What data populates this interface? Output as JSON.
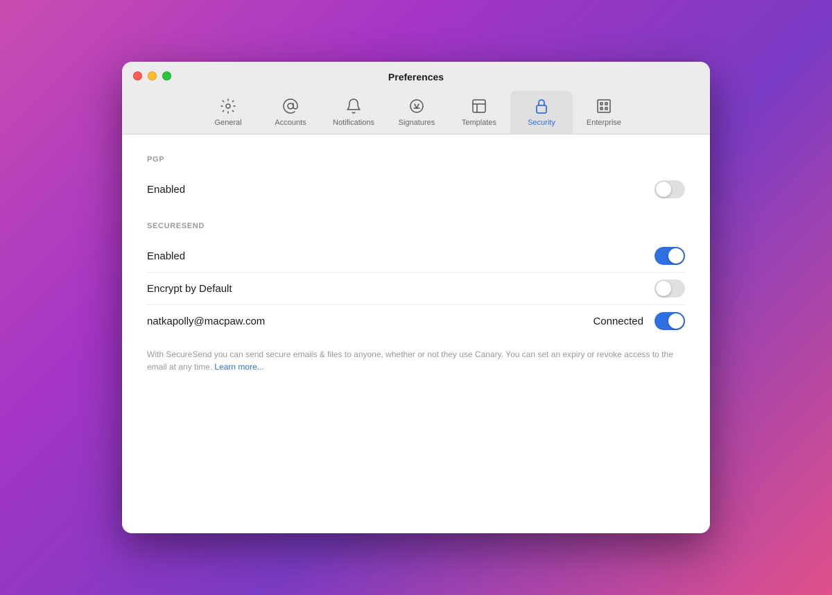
{
  "window": {
    "title": "Preferences"
  },
  "traffic_lights": {
    "close": "close",
    "minimize": "minimize",
    "maximize": "maximize"
  },
  "tabs": [
    {
      "id": "general",
      "label": "General",
      "icon": "gear-icon",
      "active": false
    },
    {
      "id": "accounts",
      "label": "Accounts",
      "icon": "at-icon",
      "active": false
    },
    {
      "id": "notifications",
      "label": "Notifications",
      "icon": "bell-icon",
      "active": false
    },
    {
      "id": "signatures",
      "label": "Signatures",
      "icon": "signature-icon",
      "active": false
    },
    {
      "id": "templates",
      "label": "Templates",
      "icon": "templates-icon",
      "active": false
    },
    {
      "id": "security",
      "label": "Security",
      "icon": "lock-icon",
      "active": true
    },
    {
      "id": "enterprise",
      "label": "Enterprise",
      "icon": "enterprise-icon",
      "active": false
    }
  ],
  "pgp_section": {
    "header": "PGP",
    "enabled_label": "Enabled",
    "enabled_state": "off"
  },
  "securesend_section": {
    "header": "SECURESEND",
    "enabled_label": "Enabled",
    "enabled_state": "on",
    "encrypt_label": "Encrypt by Default",
    "encrypt_state": "off",
    "email": "natkapolly@macpaw.com",
    "connected_label": "Connected",
    "connected_state": "on",
    "description": "With SecureSend you can send secure emails & files to anyone, whether or not they use Canary. You can set an expiry or revoke access to the email at any time.",
    "learn_more": "Learn more..."
  }
}
